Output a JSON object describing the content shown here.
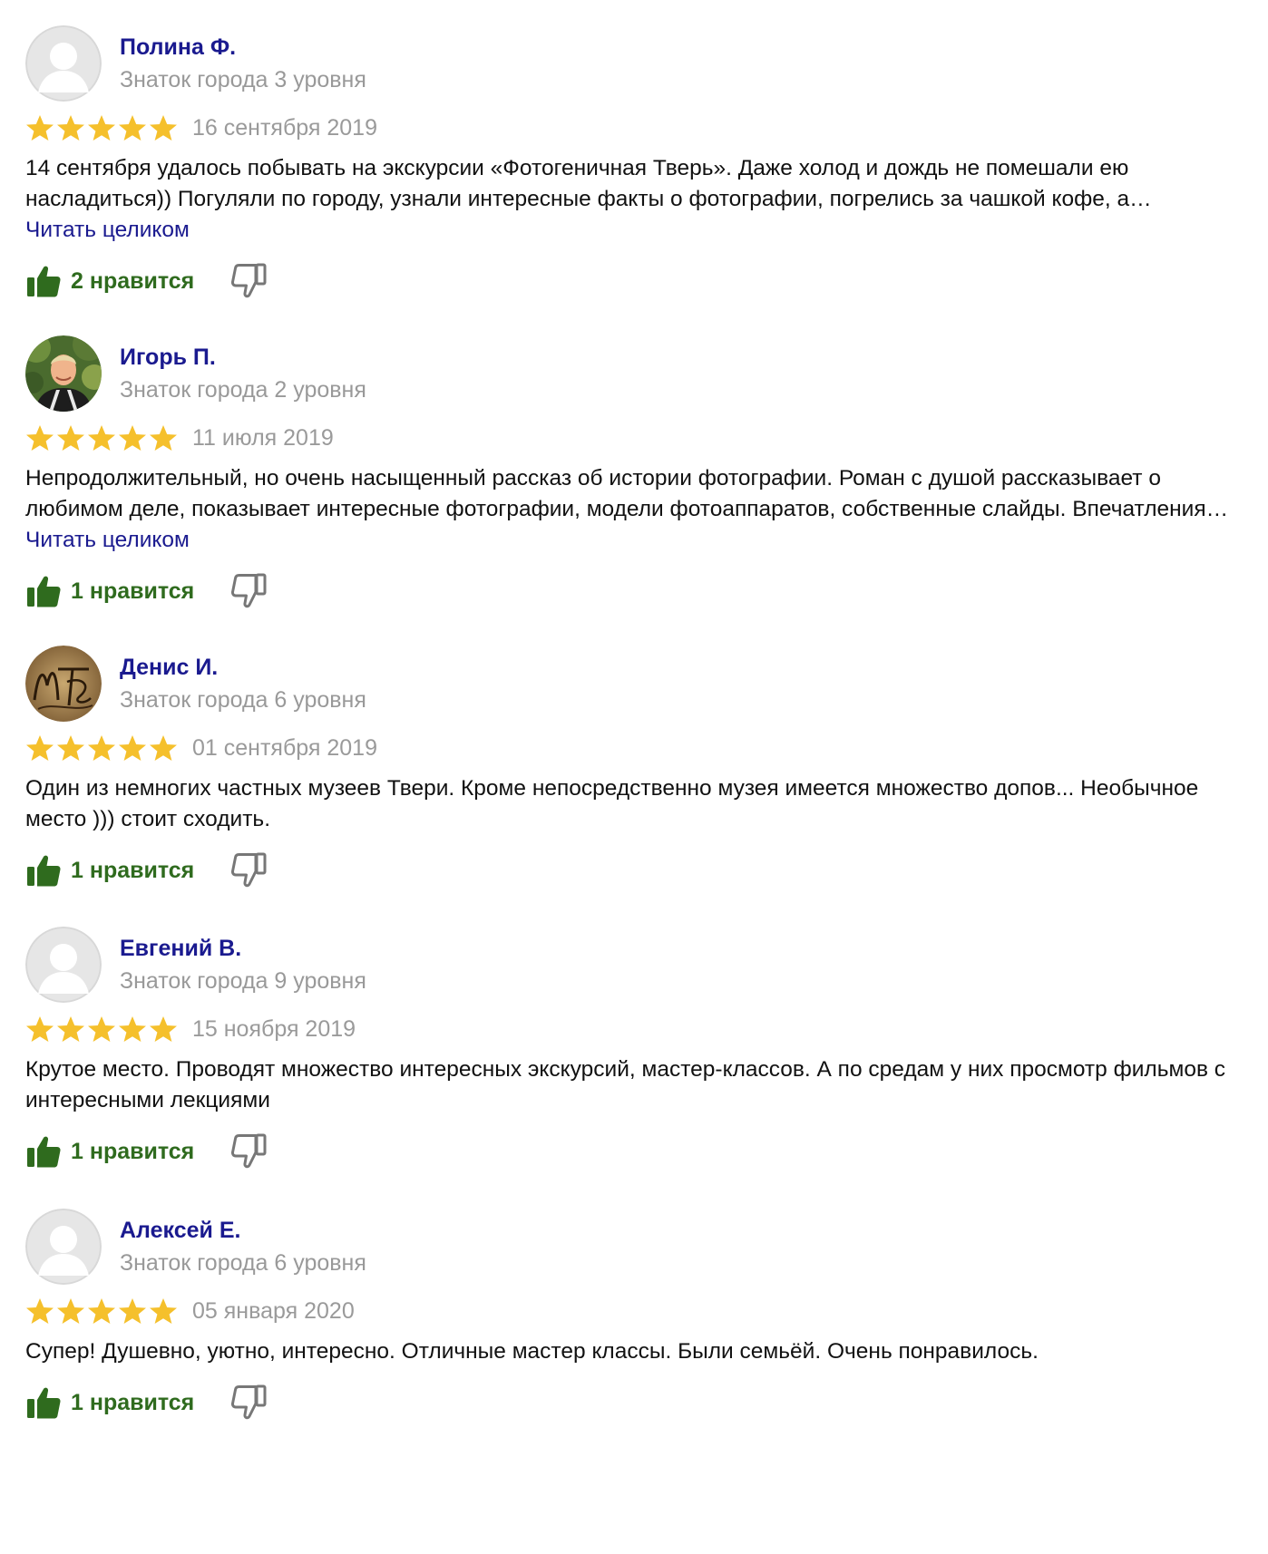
{
  "colors": {
    "author_name": "#1a1a8f",
    "secondary_text": "#999999",
    "star": "#f5c02c",
    "like": "#2f6b1e",
    "link": "#1a1a8f"
  },
  "icons": {
    "star": "star-icon",
    "like": "thumbs-up-icon",
    "dislike": "thumbs-down-icon",
    "avatar_placeholder": "user-placeholder-icon"
  },
  "reviews": [
    {
      "author": "Полина Ф.",
      "level": "Знаток города 3 уровня",
      "rating": 5,
      "date": "16 сентября 2019",
      "text": "14 сентября удалось побывать на экскурсии «Фотогеничная Тверь». Даже холод и дождь не помешали ею насладиться)) Погуляли по городу, узнали интересные факты о фотографии, погрелись за чашкой кофе, а…",
      "read_more": "Читать целиком",
      "likes_label": "2 нравится"
    },
    {
      "author": "Игорь П.",
      "level": "Знаток города 2 уровня",
      "rating": 5,
      "date": "11 июля 2019",
      "text": "Непродолжительный, но очень насыщенный рассказ об истории фотографии. Роман с душой рассказывает о любимом деле, показывает интересные фотографии, модели фотоаппаратов, собственные слайды. Впечатления…",
      "read_more": "Читать целиком",
      "likes_label": "1 нравится"
    },
    {
      "author": "Денис И.",
      "level": "Знаток города 6 уровня",
      "rating": 5,
      "date": "01 сентября 2019",
      "text": "Один из немногих частных музеев Твери. Кроме непосредственно музея имеется множество допов... Необычное место ))) стоит сходить.",
      "read_more": "",
      "likes_label": "1 нравится"
    },
    {
      "author": "Евгений В.",
      "level": "Знаток города 9 уровня",
      "rating": 5,
      "date": "15 ноября 2019",
      "text": "Крутое место. Проводят множество интересных экскурсий, мастер-классов. А по средам у них просмотр фильмов с интересными лекциями",
      "read_more": "",
      "likes_label": "1 нравится"
    },
    {
      "author": "Алексей Е.",
      "level": "Знаток города 6 уровня",
      "rating": 5,
      "date": "05 января 2020",
      "text": "Супер! Душевно, уютно, интересно. Отличные мастер классы. Были семьёй. Очень понравилось.",
      "read_more": "",
      "likes_label": "1 нравится"
    }
  ]
}
